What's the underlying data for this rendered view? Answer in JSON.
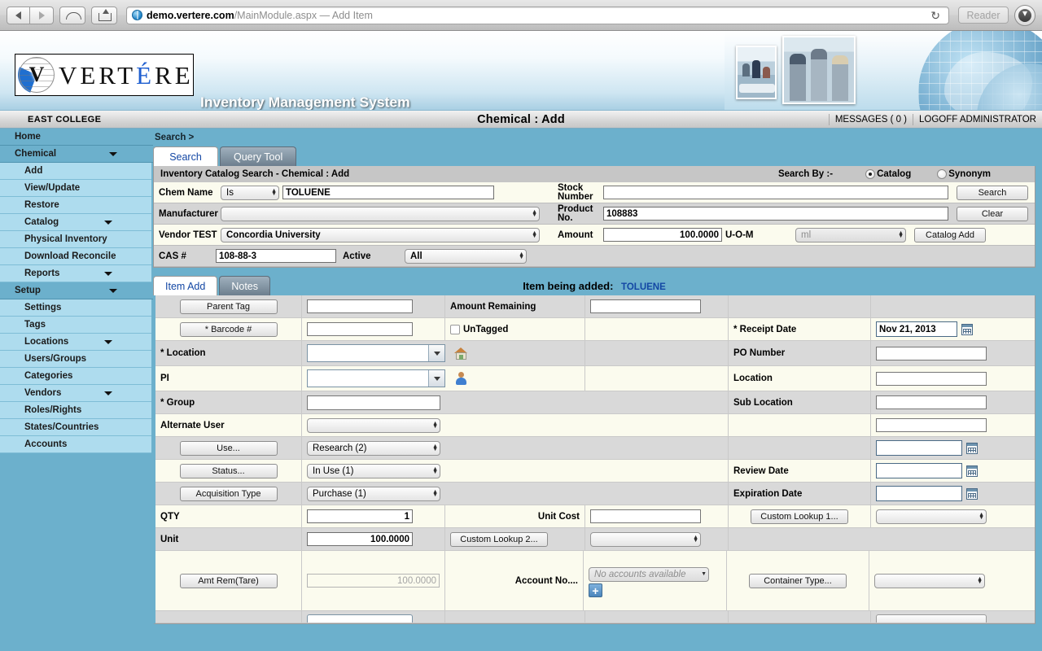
{
  "browser": {
    "back_icon": "back-arrow-icon",
    "forward_icon": "forward-arrow-icon",
    "icloud_icon": "icloud-icon",
    "share_icon": "share-icon",
    "url_host": "demo.vertere.com",
    "url_path": "/MainModule.aspx",
    "url_title": " — Add Item",
    "reload_icon": "reload-icon",
    "reader_label": "Reader",
    "downloads_icon": "downloads-icon"
  },
  "app": {
    "logo_letter": "V",
    "logo_word_a": "VERT",
    "logo_word_accent": "É",
    "logo_word_b": "RE",
    "subtitle": "Inventory Management System"
  },
  "header": {
    "org": "EAST COLLEGE",
    "title": "Chemical : Add",
    "messages": "MESSAGES ( 0 )",
    "logoff": "LOGOFF ADMINISTRATOR"
  },
  "sidebar": {
    "items": [
      {
        "label": "Home",
        "level": "top",
        "caret": false
      },
      {
        "label": "Chemical",
        "level": "top",
        "caret": true
      },
      {
        "label": "Add",
        "level": "sub",
        "caret": false
      },
      {
        "label": "View/Update",
        "level": "sub",
        "caret": false
      },
      {
        "label": "Restore",
        "level": "sub",
        "caret": false
      },
      {
        "label": "Catalog",
        "level": "sub",
        "caret": true
      },
      {
        "label": "Physical Inventory",
        "level": "sub",
        "caret": false
      },
      {
        "label": "Download Reconcile",
        "level": "sub",
        "caret": false
      },
      {
        "label": "Reports",
        "level": "sub",
        "caret": true
      },
      {
        "label": "Setup",
        "level": "top",
        "caret": true
      },
      {
        "label": "Settings",
        "level": "sub",
        "caret": false
      },
      {
        "label": "Tags",
        "level": "sub",
        "caret": false
      },
      {
        "label": "Locations",
        "level": "sub",
        "caret": true
      },
      {
        "label": "Users/Groups",
        "level": "sub",
        "caret": false
      },
      {
        "label": "Categories",
        "level": "sub",
        "caret": false
      },
      {
        "label": "Vendors",
        "level": "sub",
        "caret": true
      },
      {
        "label": "Roles/Rights",
        "level": "sub",
        "caret": false
      },
      {
        "label": "States/Countries",
        "level": "sub",
        "caret": false
      },
      {
        "label": "Accounts",
        "level": "sub",
        "caret": false
      }
    ]
  },
  "main": {
    "breadcrumb": "Search >",
    "tabs": [
      {
        "label": "Search",
        "active": true
      },
      {
        "label": "Query Tool",
        "active": false
      }
    ]
  },
  "search_panel": {
    "heading": "Inventory Catalog Search - Chemical : Add",
    "search_by_label": "Search By :-",
    "radio_catalog": "Catalog",
    "radio_synonym": "Synonym",
    "radio_selected": "Catalog",
    "chem_name_label": "Chem Name",
    "chem_name_operator": "Is",
    "chem_name_value": "TOLUENE",
    "manufacturer_label": "Manufacturer",
    "manufacturer_value": "",
    "vendor_label": "Vendor TEST",
    "vendor_value": "Concordia University",
    "cas_label": "CAS #",
    "cas_value": "108-88-3",
    "active_label": "Active",
    "active_value": "All",
    "stock_number_label": "Stock Number",
    "stock_number_value": "",
    "product_no_label": "Product No.",
    "product_no_value": "108883",
    "amount_label": "Amount",
    "amount_value": "100.0000",
    "uom_label": "U-O-M",
    "uom_value": "ml",
    "btn_search": "Search",
    "btn_clear": "Clear",
    "btn_catalog_add": "Catalog Add"
  },
  "item_add": {
    "tabs": [
      {
        "label": "Item Add",
        "active": true
      },
      {
        "label": "Notes",
        "active": false
      }
    ],
    "being_added_label": "Item being added:",
    "being_added_name": "TOLUENE",
    "parent_tag_button": "Parent Tag",
    "parent_tag_value": "",
    "amount_remaining_label": "Amount Remaining",
    "amount_remaining_value": "",
    "barcode_button": "* Barcode #",
    "barcode_value": "",
    "untagged_label": "UnTagged",
    "untagged_checked": false,
    "receipt_date_label": "* Receipt Date",
    "receipt_date_value": "Nov 21, 2013",
    "location_label": "* Location",
    "location_value": "",
    "po_number_label": "PO Number",
    "po_number_value": "",
    "pi_label": "PI",
    "pi_value": "",
    "location2_label": "Location",
    "location2_value": "",
    "group_label": "* Group",
    "group_value": "",
    "sub_location_label": "Sub Location",
    "sub_location_value": "",
    "alternate_user_label": "Alternate User",
    "alternate_user_value": "",
    "blank_date_value": "",
    "use_button": "Use...",
    "use_value": "Research (2)",
    "status_button": "Status...",
    "status_value": "In Use (1)",
    "review_date_label": "Review Date",
    "review_date_value": "",
    "acquisition_button": "Acquisition Type",
    "acquisition_value": "Purchase (1)",
    "expiration_date_label": "Expiration Date",
    "expiration_date_value": "",
    "qty_label": "QTY",
    "qty_value": "1",
    "unit_cost_label": "Unit Cost",
    "unit_cost_value": "",
    "custom_lookup1_button": "Custom Lookup 1...",
    "custom_lookup1_value": "",
    "unit_label": "Unit",
    "unit_value": "100.0000",
    "custom_lookup2_button": "Custom Lookup 2...",
    "custom_lookup2_value": "",
    "amt_rem_tare_button": "Amt Rem(Tare)",
    "amt_rem_tare_value": "100.0000",
    "account_no_label": "Account No....",
    "account_no_value": "No accounts available",
    "account_add_icon": "plus-icon",
    "container_type_button": "Container Type...",
    "container_type_value": ""
  }
}
